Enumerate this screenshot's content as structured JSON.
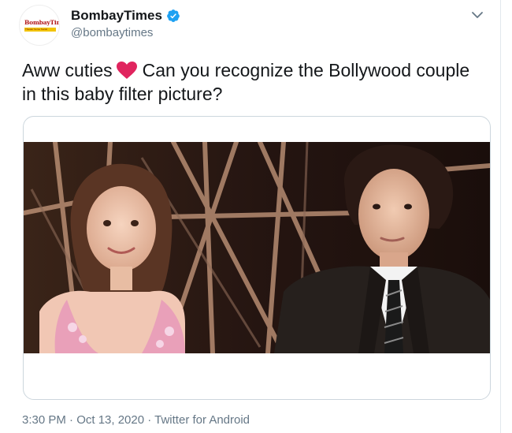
{
  "account": {
    "display_name": "BombayTimes",
    "handle": "@bombaytimes",
    "avatar_logo_text": "BombayTimes",
    "avatar_tagline": "Theater Some Social",
    "avatar_icon": "bombay-times-logo",
    "verified_icon": "verified-badge-icon"
  },
  "tweet": {
    "text_before_emoji": "Aww cuties",
    "emoji": "heart-emoji",
    "text_after_emoji": "Can you recognize the Bollywood couple in this baby filter picture?",
    "image_description_icon": "tweet-photo"
  },
  "meta": {
    "timestamp": "3:30 PM · Oct 13, 2020 · Twitter for Android"
  },
  "menu_icon": "chevron-down-icon",
  "colors": {
    "text": "#14171a",
    "secondary": "#657786",
    "verified": "#1da1f2",
    "heart": "#e0245e",
    "border": "#ccd6dd"
  }
}
